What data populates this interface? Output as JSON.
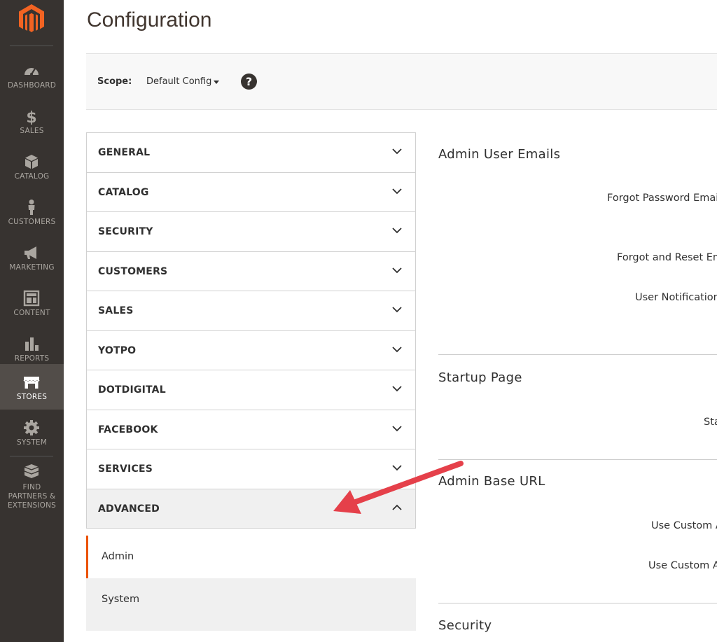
{
  "sidebar": {
    "items": [
      {
        "label": "DASHBOARD",
        "icon": "dashboard-icon"
      },
      {
        "label": "SALES",
        "icon": "dollar-icon"
      },
      {
        "label": "CATALOG",
        "icon": "box-icon"
      },
      {
        "label": "CUSTOMERS",
        "icon": "person-icon"
      },
      {
        "label": "MARKETING",
        "icon": "megaphone-icon"
      },
      {
        "label": "CONTENT",
        "icon": "layout-icon"
      },
      {
        "label": "REPORTS",
        "icon": "bar-chart-icon"
      },
      {
        "label": "STORES",
        "icon": "storefront-icon",
        "active": true
      },
      {
        "label": "SYSTEM",
        "icon": "gear-icon"
      },
      {
        "label": "FIND PARTNERS & EXTENSIONS",
        "icon": "blocks-icon"
      }
    ]
  },
  "page": {
    "title": "Configuration"
  },
  "scope": {
    "label": "Scope:",
    "value": "Default Config",
    "help_icon": "question-icon"
  },
  "tabs": [
    {
      "label": "GENERAL"
    },
    {
      "label": "CATALOG"
    },
    {
      "label": "SECURITY"
    },
    {
      "label": "CUSTOMERS"
    },
    {
      "label": "SALES"
    },
    {
      "label": "YOTPO"
    },
    {
      "label": "DOTDIGITAL"
    },
    {
      "label": "FACEBOOK"
    },
    {
      "label": "SERVICES"
    },
    {
      "label": "ADVANCED",
      "open": true
    }
  ],
  "subitems": [
    {
      "label": "Admin",
      "active": true
    },
    {
      "label": "System"
    }
  ],
  "content": {
    "sections": [
      {
        "title": "Admin User Emails",
        "fields": [
          "Forgot Password Emai",
          "Forgot and Reset Em",
          "User Notification"
        ]
      },
      {
        "title": "Startup Page",
        "fields": [
          "Sta"
        ]
      },
      {
        "title": "Admin Base URL",
        "fields": [
          "Use Custom A",
          "Use Custom A"
        ]
      },
      {
        "title": "Security",
        "fields": []
      }
    ]
  },
  "colors": {
    "sidebar_bg": "#373330",
    "sidebar_active": "#524d49",
    "brand_orange": "#eb5202",
    "arrow_red": "#e5404a"
  }
}
